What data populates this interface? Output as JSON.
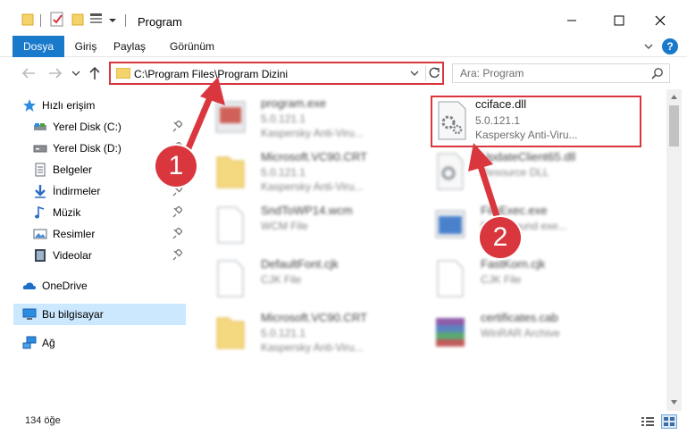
{
  "window": {
    "title": "Program",
    "minimize_glyph": "—",
    "maximize_glyph": "☐",
    "close_glyph": "✕"
  },
  "ribbon": {
    "tabs": [
      {
        "label": "Dosya"
      },
      {
        "label": "Giriş"
      },
      {
        "label": "Paylaş"
      },
      {
        "label": "Görünüm"
      }
    ],
    "help": "?"
  },
  "navbar": {
    "address": "C:\\Program Files\\Program Dizini",
    "search_placeholder": "Ara: Program"
  },
  "sidebar": {
    "items": [
      {
        "label": "Hızlı erişim",
        "icon": "star-icon"
      },
      {
        "label": "Yerel Disk (C:)",
        "icon": "drive-icon",
        "pinned": true
      },
      {
        "label": "Yerel Disk (D:)",
        "icon": "drive-icon",
        "pinned": true
      },
      {
        "label": "Belgeler",
        "icon": "document-icon",
        "pinned": true
      },
      {
        "label": "İndirmeler",
        "icon": "download-icon",
        "pinned": true
      },
      {
        "label": "Müzik",
        "icon": "music-icon",
        "pinned": true
      },
      {
        "label": "Resimler",
        "icon": "pictures-icon",
        "pinned": true
      },
      {
        "label": "Videolar",
        "icon": "video-icon",
        "pinned": true
      },
      {
        "label": "OneDrive",
        "icon": "cloud-icon"
      },
      {
        "label": "Bu bilgisayar",
        "icon": "computer-icon",
        "selected": true
      },
      {
        "label": "Ağ",
        "icon": "network-icon"
      }
    ]
  },
  "files": {
    "left": [
      {
        "name": "program.exe",
        "line2": "5.0.121.1",
        "line3": "Kaspersky Anti-Viru..."
      },
      {
        "name": "Microsoft.VC90.CRT",
        "line2": "5.0.121.1",
        "line3": "Kaspersky Anti-Viru..."
      },
      {
        "name": "SndToWP14.wcm",
        "line2": "WCM File",
        "line3": ""
      },
      {
        "name": "DefaultFont.cjk",
        "line2": "CJK File",
        "line3": ""
      },
      {
        "name": "Microsoft.VC90.CRT",
        "line2": "5.0.121.1",
        "line3": "Kaspersky Anti-Viru..."
      }
    ],
    "right": [
      {
        "name": "cciface.dll",
        "line2": "5.0.121.1",
        "line3": "Kaspersky Anti-Viru..."
      },
      {
        "name": "UpdateClient65.dll",
        "line2": "Resource DLL",
        "line3": ""
      },
      {
        "name": "FileExec.exe",
        "line2": "Background exe...",
        "line3": ""
      },
      {
        "name": "FastKorn.cjk",
        "line2": "CJK File",
        "line3": ""
      },
      {
        "name": "certificates.cab",
        "line2": "WinRAR Archive",
        "line3": ""
      }
    ]
  },
  "status": {
    "count": "134 öğe"
  },
  "annotations": {
    "step1": "1",
    "step2": "2",
    "color": "#d9363e"
  }
}
